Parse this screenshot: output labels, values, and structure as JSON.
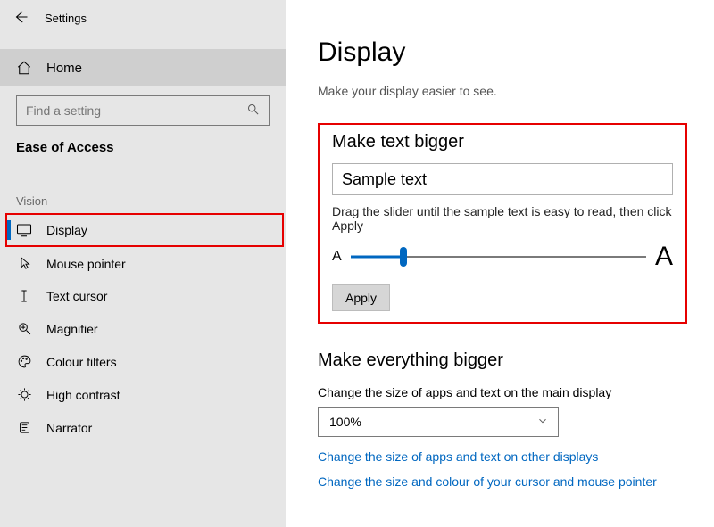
{
  "titlebar": {
    "title": "Settings"
  },
  "sidebar": {
    "home_label": "Home",
    "search_placeholder": "Find a setting",
    "category": "Ease of Access",
    "group": "Vision",
    "items": [
      {
        "label": "Display"
      },
      {
        "label": "Mouse pointer"
      },
      {
        "label": "Text cursor"
      },
      {
        "label": "Magnifier"
      },
      {
        "label": "Colour filters"
      },
      {
        "label": "High contrast"
      },
      {
        "label": "Narrator"
      }
    ]
  },
  "page": {
    "title": "Display",
    "subtitle": "Make your display easier to see."
  },
  "text_bigger": {
    "heading": "Make text bigger",
    "sample": "Sample text",
    "hint": "Drag the slider until the sample text is easy to read, then click Apply",
    "small_a": "A",
    "big_a": "A",
    "apply_label": "Apply",
    "slider_pct": 18
  },
  "everything_bigger": {
    "heading": "Make everything bigger",
    "label": "Change the size of apps and text on the main display",
    "value": "100%",
    "link1": "Change the size of apps and text on other displays",
    "link2": "Change the size and colour of your cursor and mouse pointer"
  }
}
